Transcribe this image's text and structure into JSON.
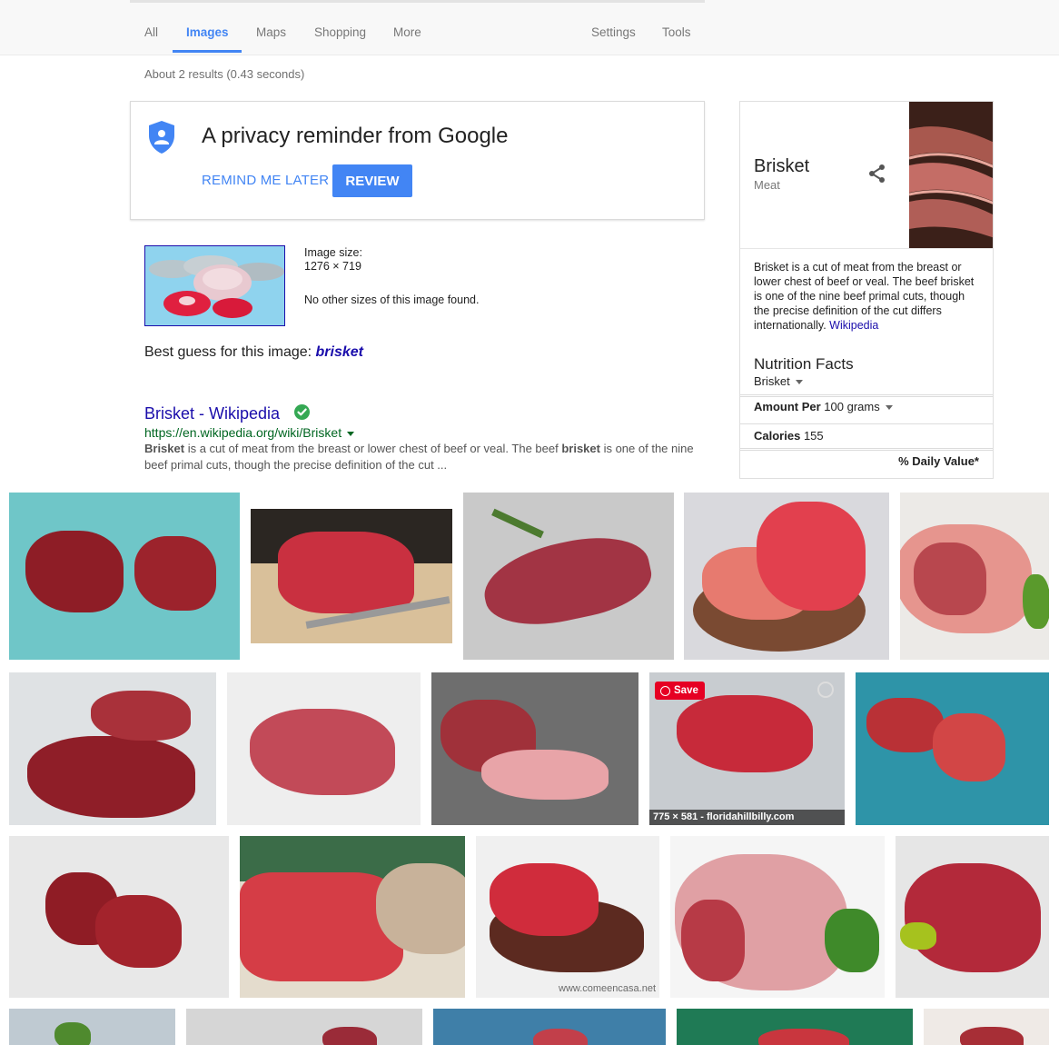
{
  "tabs": [
    {
      "label": "All"
    },
    {
      "label": "Images"
    },
    {
      "label": "Maps"
    },
    {
      "label": "Shopping"
    },
    {
      "label": "More"
    }
  ],
  "tools": {
    "settings": "Settings",
    "tools": "Tools"
  },
  "stats": "About 2 results (0.43 seconds)",
  "privacy": {
    "title": "A privacy reminder from Google",
    "remind": "REMIND ME LATER",
    "review": "REVIEW"
  },
  "image_info": {
    "size_label": "Image size:",
    "size_value": "1276 × 719",
    "no_other": "No other sizes of this image found."
  },
  "best_guess": {
    "prefix": "Best guess for this image: ",
    "term": "brisket"
  },
  "result": {
    "title": "Brisket - Wikipedia",
    "url": "https://en.wikipedia.org/wiki/Brisket",
    "snippet_parts": [
      "Brisket",
      " is a cut of meat from the breast or lower chest of beef or veal. The beef ",
      "brisket",
      " is one of the nine beef primal cuts, though the precise definition of the cut ..."
    ]
  },
  "knowledge_panel": {
    "title": "Brisket",
    "subtitle": "Meat",
    "description": "Brisket is a cut of meat from the breast or lower chest of beef or veal. The beef brisket is one of the nine beef primal cuts, though the precise definition of the cut differs internationally.",
    "source": "Wikipedia",
    "nutrition_title": "Nutrition Facts",
    "nutrition_item": "Brisket",
    "amount_label": "Amount Per",
    "amount_value": "100 grams",
    "calories_label": "Calories",
    "calories_value": "155",
    "daily_value": "% Daily Value*"
  },
  "image_results": {
    "save_label": "Save",
    "caption": "775 × 581 - floridahillbilly.com",
    "watermark": "www.comeencasa.net"
  },
  "colors": {
    "accent": "#4285f4",
    "link": "#1a0dab",
    "url": "#006621",
    "verified": "#34a853",
    "pinterest": "#e60023"
  }
}
